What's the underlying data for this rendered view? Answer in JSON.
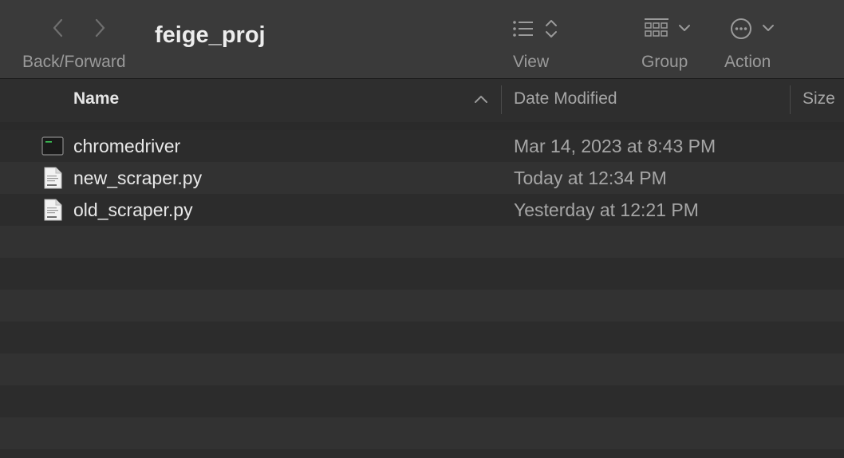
{
  "window": {
    "title": "feige_proj"
  },
  "toolbar": {
    "nav_label": "Back/Forward",
    "view_label": "View",
    "group_label": "Group",
    "action_label": "Action",
    "icons": {
      "back": "chevron-left-icon",
      "forward": "chevron-right-icon",
      "view": "list-view-icon",
      "view_toggle": "up-down-chevron-icon",
      "group": "grid-group-icon",
      "action": "ellipsis-circle-icon"
    }
  },
  "columns": {
    "name": "Name",
    "date": "Date Modified",
    "size": "Size",
    "sort": "ascending"
  },
  "files": [
    {
      "name": "chromedriver",
      "date": "Mar 14, 2023 at 8:43 PM",
      "icon": "terminal-exec-icon"
    },
    {
      "name": "new_scraper.py",
      "date": "Today at 12:34 PM",
      "icon": "python-file-icon"
    },
    {
      "name": "old_scraper.py",
      "date": "Yesterday at 12:21 PM",
      "icon": "python-file-icon"
    }
  ],
  "colors": {
    "toolbar": "#3a3a3a",
    "row_light": "#323232",
    "row_dark": "#2c2c2c"
  }
}
